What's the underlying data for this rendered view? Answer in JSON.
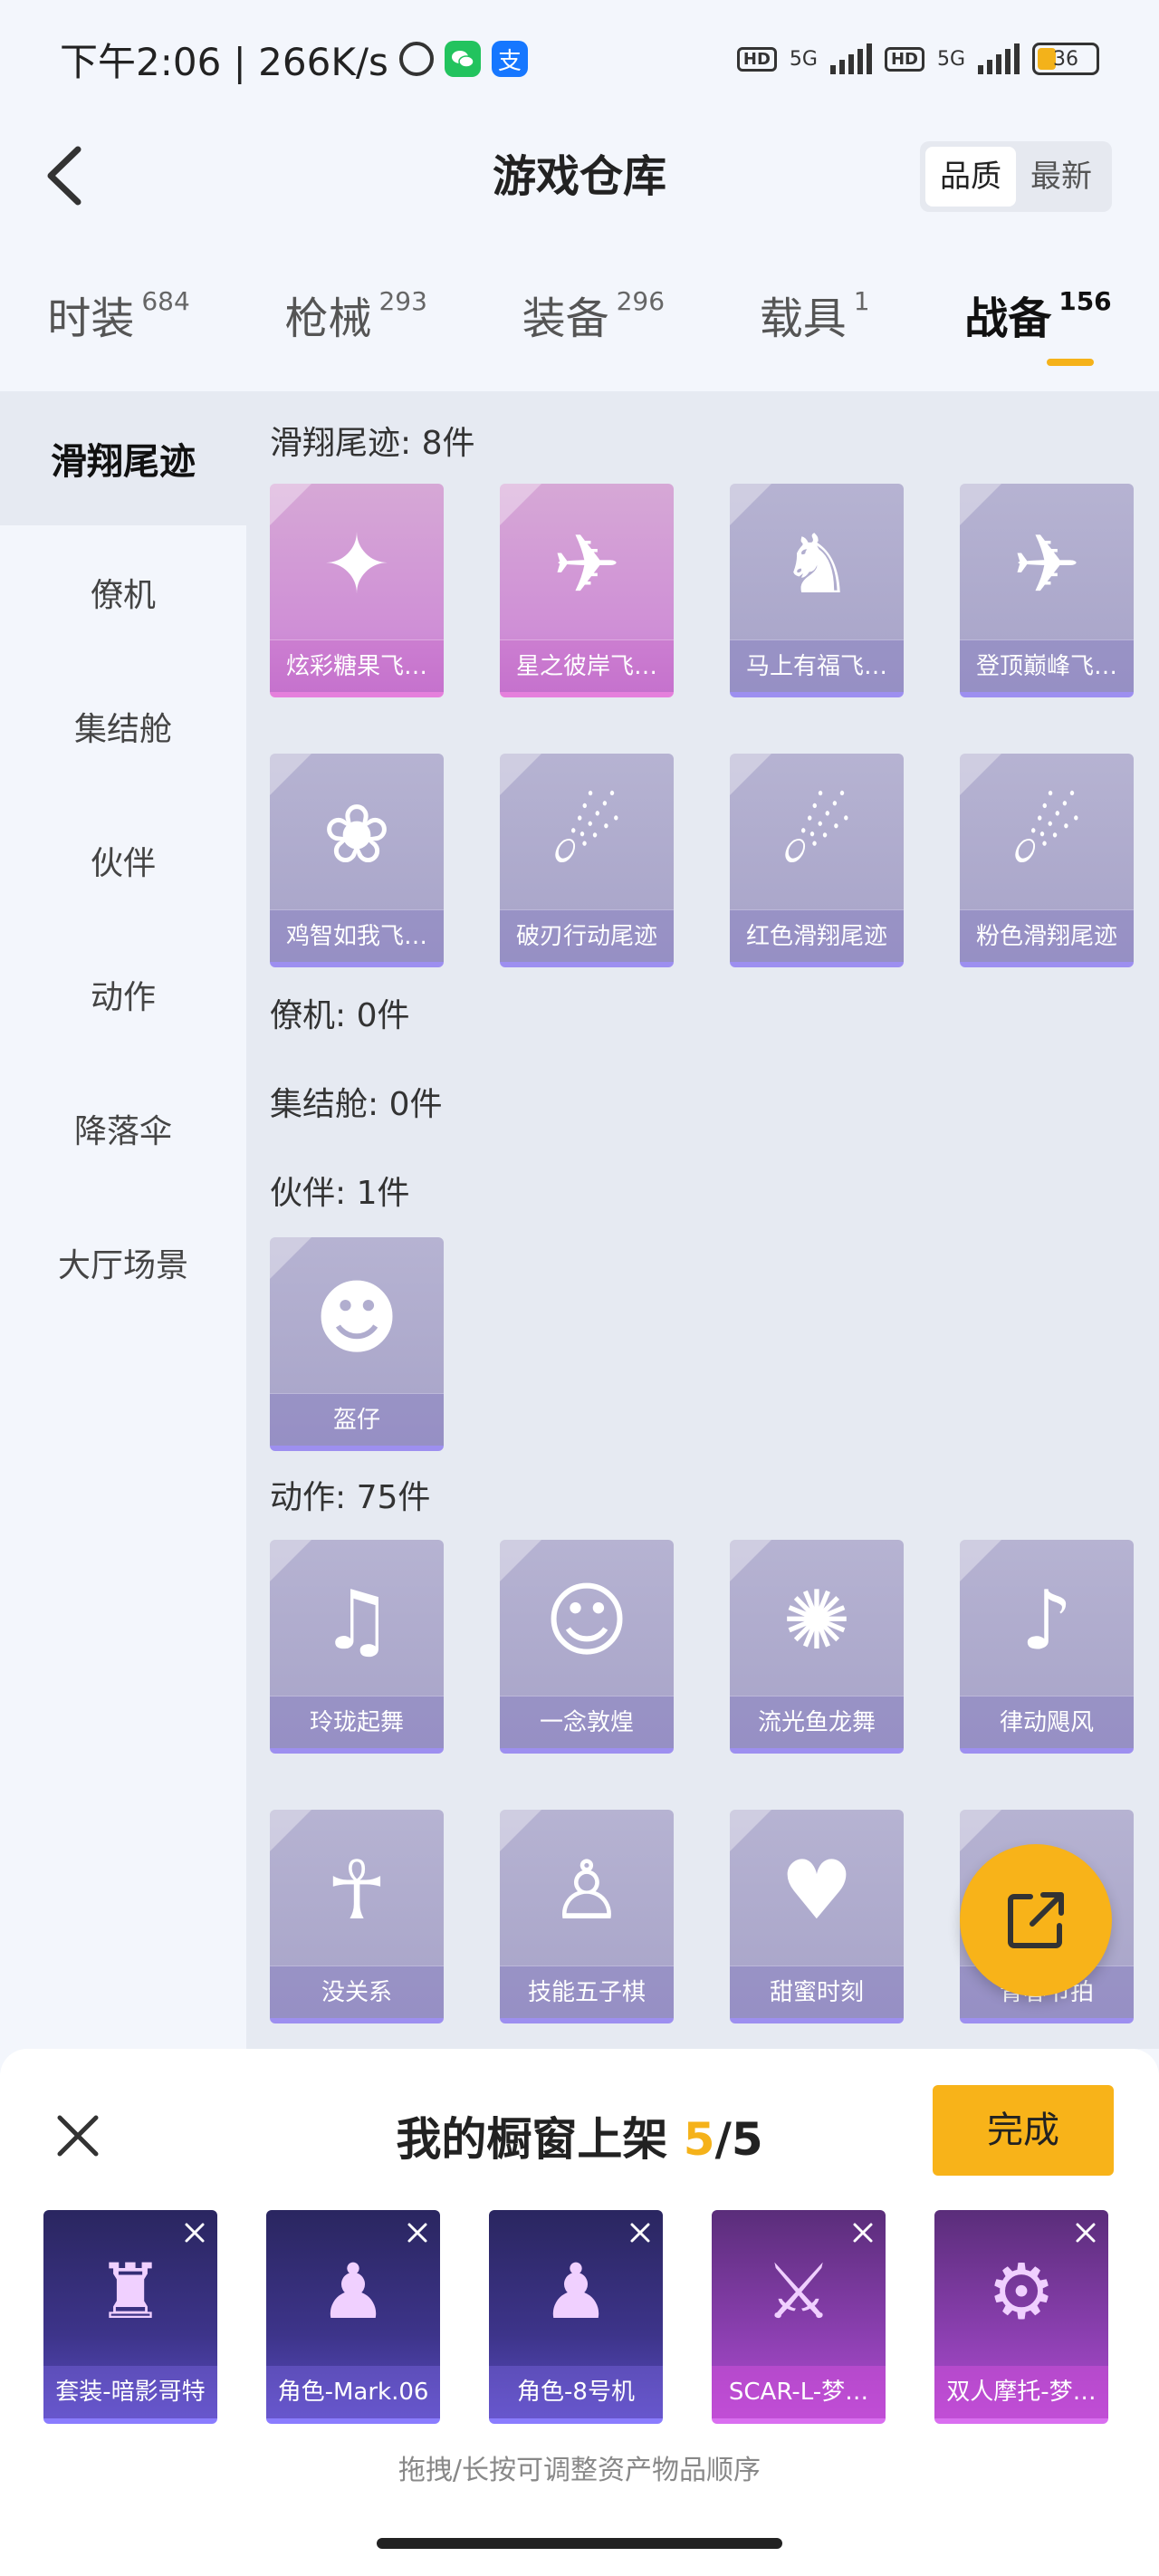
{
  "status_bar": {
    "time": "下午2:06 | 266K/s",
    "wechat_icon": "wechat-icon",
    "alipay_glyph": "支",
    "hd1": "HD",
    "net1": "5G",
    "hd2": "HD",
    "net2": "5G",
    "battery": "36"
  },
  "header": {
    "title": "游戏仓库",
    "sort_options": [
      "品质",
      "最新"
    ],
    "active_sort": "品质"
  },
  "tabs": [
    {
      "label": "时装",
      "count": "684"
    },
    {
      "label": "枪械",
      "count": "293"
    },
    {
      "label": "装备",
      "count": "296"
    },
    {
      "label": "载具",
      "count": "1"
    },
    {
      "label": "战备",
      "count": "156",
      "active": true
    }
  ],
  "sidebar": {
    "items": [
      "滑翔尾迹",
      "僚机",
      "集结舱",
      "伙伴",
      "动作",
      "降落伞",
      "大厅场景"
    ],
    "active": "滑翔尾迹"
  },
  "sections": {
    "glide": {
      "title": "滑翔尾迹: 8件",
      "items": [
        "炫彩糖果飞…",
        "星之彼岸飞…",
        "马上有福飞…",
        "登顶巅峰飞…",
        "鸡智如我飞…",
        "破刃行动尾迹",
        "红色滑翔尾迹",
        "粉色滑翔尾迹"
      ]
    },
    "wingman": {
      "title": "僚机: 0件"
    },
    "pod": {
      "title": "集结舱: 0件"
    },
    "partner": {
      "title": "伙伴: 1件",
      "items": [
        "盔仔"
      ]
    },
    "emote": {
      "title": "动作: 75件",
      "items": [
        "玲珑起舞",
        "一念敦煌",
        "流光鱼龙舞",
        "律动飓风",
        "没关系",
        "技能五子棋",
        "甜蜜时刻",
        "青春节拍"
      ]
    }
  },
  "panel": {
    "title_prefix": "我的橱窗上架 ",
    "count_current": "5",
    "count_sep": "/5",
    "done_label": "完成",
    "items": [
      "套装-暗影哥特",
      "角色-Mark.06",
      "角色-8号机",
      "SCAR-L-梦…",
      "双人摩托-梦…"
    ],
    "hint": "拖拽/长按可调整资产物品顺序"
  },
  "colors": {
    "accent": "#f8b319",
    "quality_pink": "#cf8fd6",
    "quality_purple": "#a7a3c8"
  }
}
